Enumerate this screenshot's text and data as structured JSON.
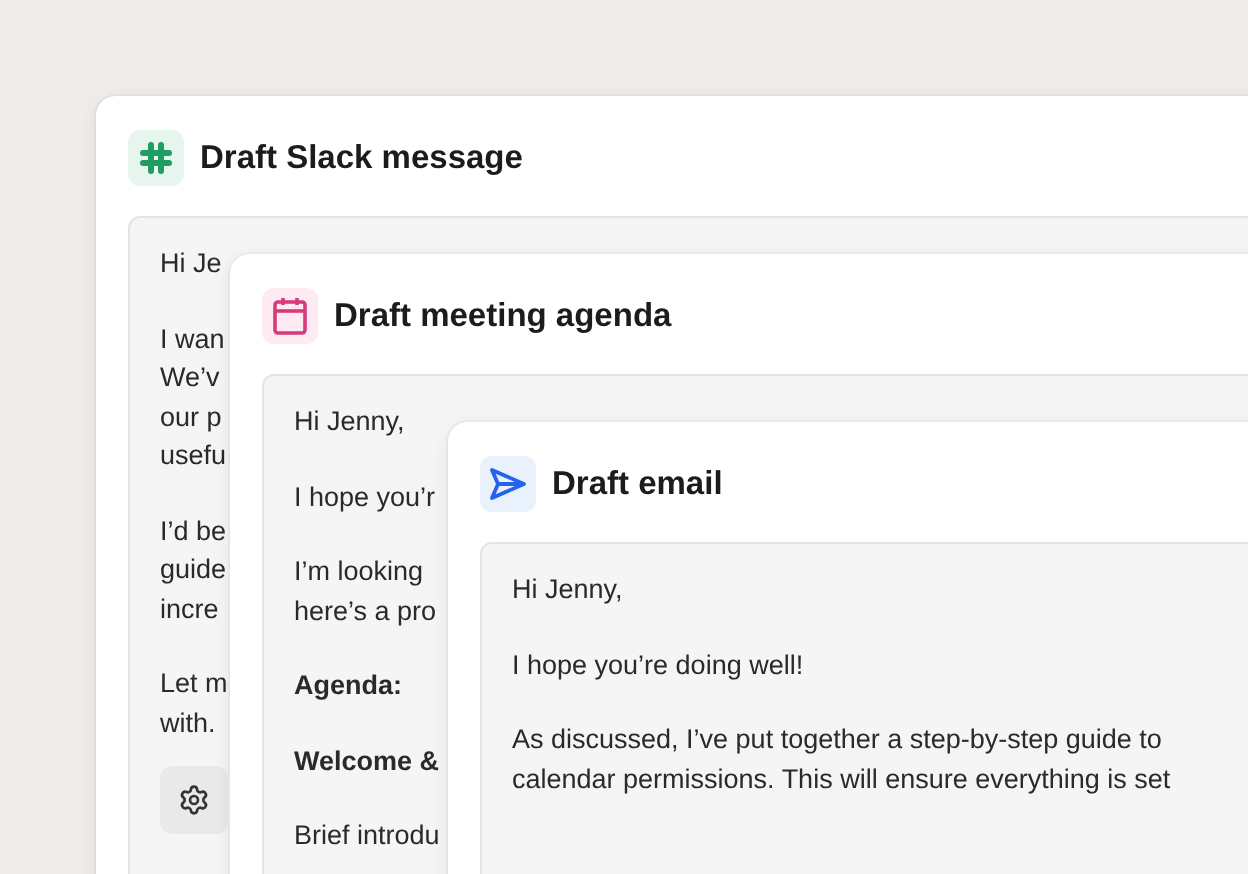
{
  "cards": [
    {
      "kind": "slack",
      "title": "Draft Slack message",
      "paragraphs": [
        {
          "bold": false,
          "lines": [
            "Hi Je"
          ]
        },
        {
          "bold": false,
          "lines": [
            "I wan",
            "We’v",
            "our p",
            "usefu"
          ]
        },
        {
          "bold": false,
          "lines": [
            "I’d be",
            "guide",
            "incre"
          ]
        },
        {
          "bold": false,
          "lines": [
            "Let m",
            "with."
          ]
        }
      ],
      "actions": [
        {
          "kind": "settings"
        }
      ]
    },
    {
      "kind": "calendar",
      "title": "Draft meeting agenda",
      "paragraphs": [
        {
          "bold": false,
          "lines": [
            "Hi Jenny,"
          ]
        },
        {
          "bold": false,
          "lines": [
            "I hope you’r"
          ]
        },
        {
          "bold": false,
          "lines": [
            "I’m looking",
            "here’s a pro"
          ]
        },
        {
          "bold": true,
          "lines": [
            "Agenda:"
          ]
        },
        {
          "bold": true,
          "lines": [
            "Welcome &"
          ]
        },
        {
          "bold": false,
          "lines": [
            "Brief introdu"
          ]
        }
      ]
    },
    {
      "kind": "send",
      "title": "Draft email",
      "paragraphs": [
        {
          "bold": false,
          "lines": [
            "Hi Jenny,"
          ]
        },
        {
          "bold": false,
          "lines": [
            "I hope you’re doing well!"
          ]
        },
        {
          "bold": false,
          "lines": [
            "As discussed, I’ve put together a step-by-step guide to",
            "calendar permissions. This will ensure everything is set"
          ]
        }
      ]
    }
  ]
}
